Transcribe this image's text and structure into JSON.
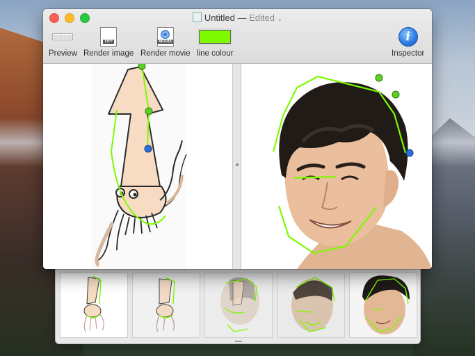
{
  "window": {
    "title": "Untitled",
    "separator": "—",
    "status": "Edited",
    "status_chevron": "⌄"
  },
  "toolbar": {
    "preview_label": "Preview",
    "render_image_label": "Render image",
    "tiff_tag": "TIFF",
    "render_movie_label": "Render movie",
    "movie_tag": "MOVIE",
    "line_colour_label": "line colour",
    "inspector_label": "Inspector",
    "inspector_glyph": "i"
  },
  "colors": {
    "line_colour": "#7dfa00",
    "control_point_green": "#5bd01f",
    "control_point_blue": "#2a6fd6"
  },
  "icons": [
    "preview-icon",
    "tiff-file-icon",
    "movie-file-icon",
    "color-swatch",
    "info-icon"
  ],
  "filmstrip": {
    "frames": [
      "frame-1",
      "frame-2",
      "frame-3",
      "frame-4",
      "frame-5"
    ]
  }
}
